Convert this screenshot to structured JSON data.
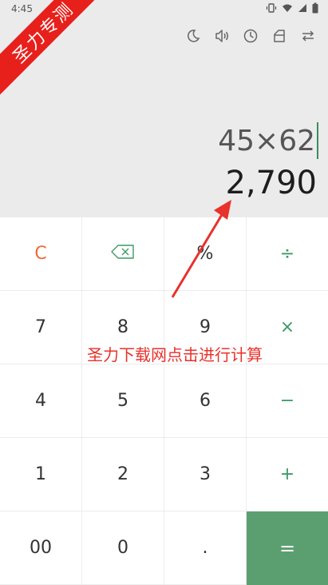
{
  "status_bar": {
    "time": "4:45",
    "icons": [
      "vibrate-icon",
      "wifi-icon",
      "signal-icon",
      "battery-icon"
    ]
  },
  "toolbar": {
    "icons": [
      "night-mode-icon",
      "sound-icon",
      "history-icon",
      "scientific-icon",
      "convert-icon"
    ]
  },
  "display": {
    "expression": "45×62",
    "result": "2,790"
  },
  "keypad": {
    "clear": "C",
    "percent": "%",
    "divide": "÷",
    "seven": "7",
    "eight": "8",
    "nine": "9",
    "multiply": "×",
    "four": "4",
    "five": "5",
    "six": "6",
    "minus": "−",
    "one": "1",
    "two": "2",
    "three": "3",
    "plus": "+",
    "double_zero": "00",
    "zero": "0",
    "decimal": ".",
    "equals": "="
  },
  "watermark": {
    "banner": "圣力专测",
    "annotation": "圣力下载网点击进行计算"
  },
  "colors": {
    "accent": "#3d9a67",
    "equals_bg": "#5b9f71",
    "clear": "#ef6a3a",
    "annotation": "#e8322c"
  }
}
